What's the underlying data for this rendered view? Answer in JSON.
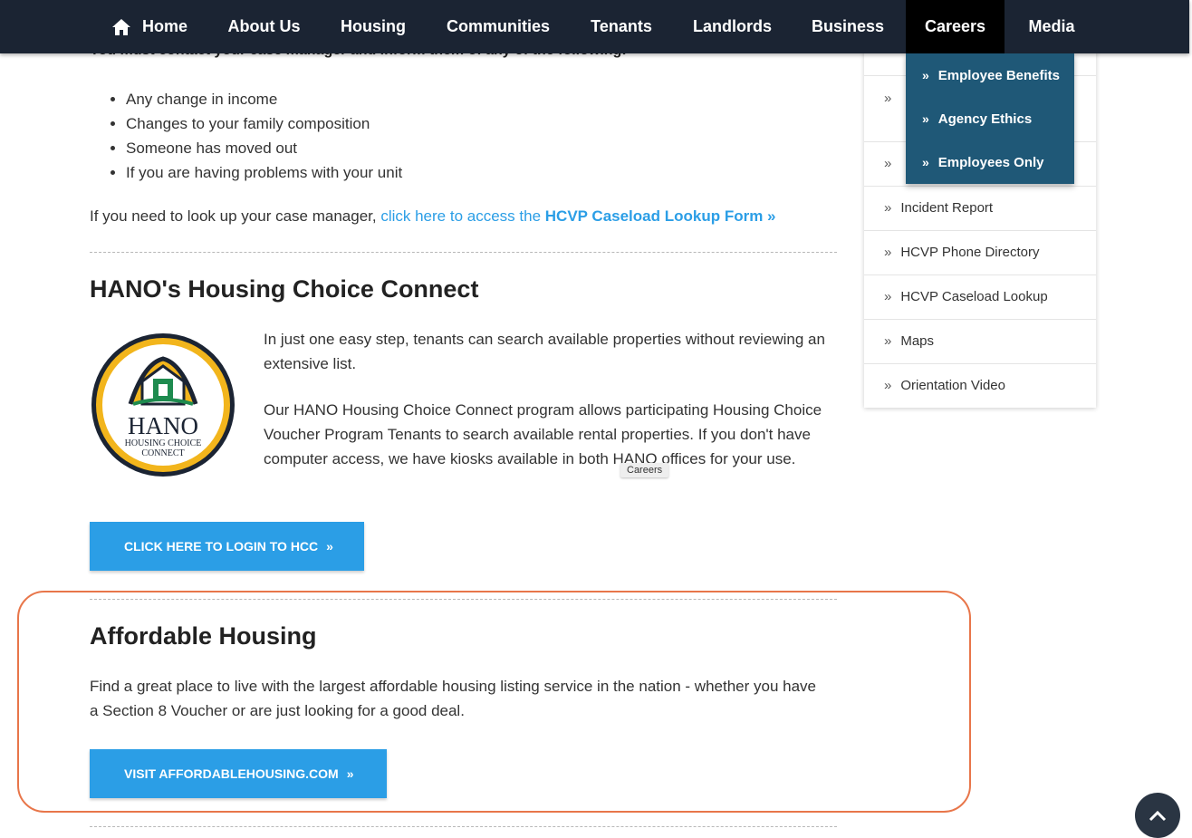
{
  "nav": {
    "items": [
      "Home",
      "About Us",
      "Housing",
      "Communities",
      "Tenants",
      "Landlords",
      "Business",
      "Careers",
      "Media"
    ],
    "active": "Careers",
    "dropdown": [
      "Employee Benefits",
      "Agency Ethics",
      "Employees Only"
    ]
  },
  "sidebar": {
    "items": [
      "Incident Report",
      "HCVP Phone Directory",
      "HCVP Caseload Lookup",
      "Maps",
      "Orientation Video"
    ]
  },
  "content": {
    "contact_heading": "You must contact your case manager and inform them of any of the following:",
    "changes": [
      "Any change in income",
      "Changes to your family composition",
      "Someone has moved out",
      "If you are having problems with your unit"
    ],
    "lookup_prefix": "If you need to look up your case manager,",
    "lookup_link_text": "click here to access the",
    "lookup_link_bold": "HCVP Caseload Lookup Form »",
    "hcc": {
      "title": "HANO's Housing Choice Connect",
      "p1": "In just one easy step, tenants can search available properties without reviewing an extensive list.",
      "p2": "Our HANO Housing Choice Connect program allows participating Housing Choice Voucher Program Tenants to search available rental properties. If you don't have computer access, we have kiosks available in both HANO offices for your use.",
      "button": "CLICK HERE TO LOGIN TO HCC",
      "logo_name": "HANO",
      "logo_sub1": "HOUSING CHOICE",
      "logo_sub2": "CONNECT"
    },
    "affordable": {
      "title": "Affordable Housing",
      "text": "Find a great place to live with the largest affordable housing listing service in the nation - whether you have a Section 8 Voucher or are just looking for a good deal.",
      "button": "VISIT AFFORDABLEHOUSING.COM"
    }
  },
  "tooltip": "Careers",
  "chevron": "»",
  "colors": {
    "nav_bg": "#1b2433",
    "dropdown_bg": "#1f5877",
    "accent": "#2b9ee6",
    "highlight": "#e8764a"
  }
}
